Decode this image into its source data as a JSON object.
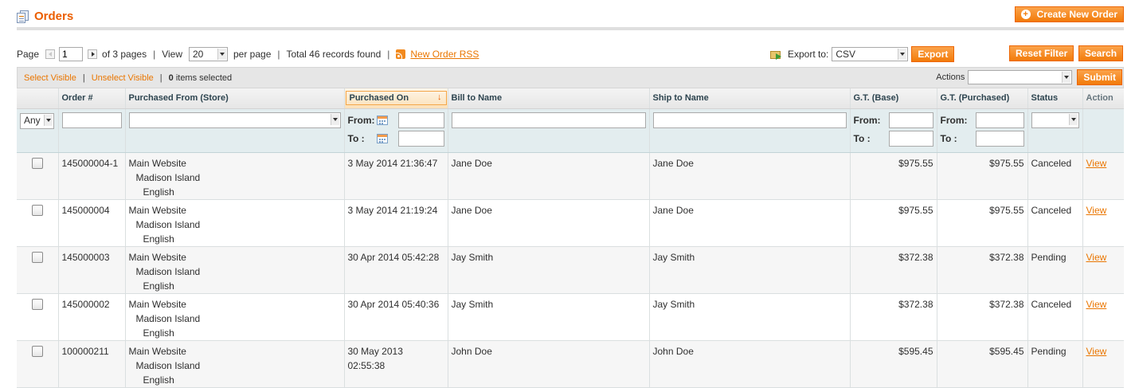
{
  "header": {
    "title": "Orders",
    "create_label": "Create New Order"
  },
  "pager": {
    "page_label": "Page",
    "page_value": "1",
    "of_pages": "of 3 pages",
    "view_label": "View",
    "per_page_value": "20",
    "per_page_label": "per page",
    "records": "Total 46 records found",
    "rss_label": "New Order RSS"
  },
  "export": {
    "label": "Export to:",
    "format": "CSV",
    "button": "Export"
  },
  "buttons": {
    "reset": "Reset Filter",
    "search": "Search"
  },
  "massaction": {
    "select_visible": "Select Visible",
    "unselect_visible": "Unselect Visible",
    "selected_count": "0",
    "selected_label": "items selected",
    "actions_label": "Actions",
    "submit": "Submit"
  },
  "columns": {
    "order": "Order #",
    "store": "Purchased From (Store)",
    "purchased_on": "Purchased On",
    "bill_to": "Bill to Name",
    "ship_to": "Ship to Name",
    "gt_base": "G.T. (Base)",
    "gt_purchased": "G.T. (Purchased)",
    "status": "Status",
    "action": "Action"
  },
  "filter": {
    "any": "Any",
    "from": "From:",
    "to": "To :"
  },
  "rows": [
    {
      "order": "145000004-1",
      "store1": "Main Website",
      "store2": "Madison Island",
      "store3": "English",
      "date": "3 May 2014 21:36:47",
      "date2": "",
      "bill": "Jane Doe",
      "ship": "Jane Doe",
      "gt_base": "$975.55",
      "gt_purchased": "$975.55",
      "status": "Canceled",
      "action": "View"
    },
    {
      "order": "145000004",
      "store1": "Main Website",
      "store2": "Madison Island",
      "store3": "English",
      "date": "3 May 2014 21:19:24",
      "date2": "",
      "bill": "Jane Doe",
      "ship": "Jane Doe",
      "gt_base": "$975.55",
      "gt_purchased": "$975.55",
      "status": "Canceled",
      "action": "View"
    },
    {
      "order": "145000003",
      "store1": "Main Website",
      "store2": "Madison Island",
      "store3": "English",
      "date": "30 Apr 2014 05:42:28",
      "date2": "",
      "bill": "Jay Smith",
      "ship": "Jay Smith",
      "gt_base": "$372.38",
      "gt_purchased": "$372.38",
      "status": "Pending",
      "action": "View"
    },
    {
      "order": "145000002",
      "store1": "Main Website",
      "store2": "Madison Island",
      "store3": "English",
      "date": "30 Apr 2014 05:40:36",
      "date2": "",
      "bill": "Jay Smith",
      "ship": "Jay Smith",
      "gt_base": "$372.38",
      "gt_purchased": "$372.38",
      "status": "Canceled",
      "action": "View"
    },
    {
      "order": "100000211",
      "store1": "Main Website",
      "store2": "Madison Island",
      "store3": "English",
      "date": "30 May 2013",
      "date2": "02:55:38",
      "bill": "John Doe",
      "ship": "John Doe",
      "gt_base": "$595.45",
      "gt_purchased": "$595.45",
      "status": "Pending",
      "action": "View"
    }
  ]
}
